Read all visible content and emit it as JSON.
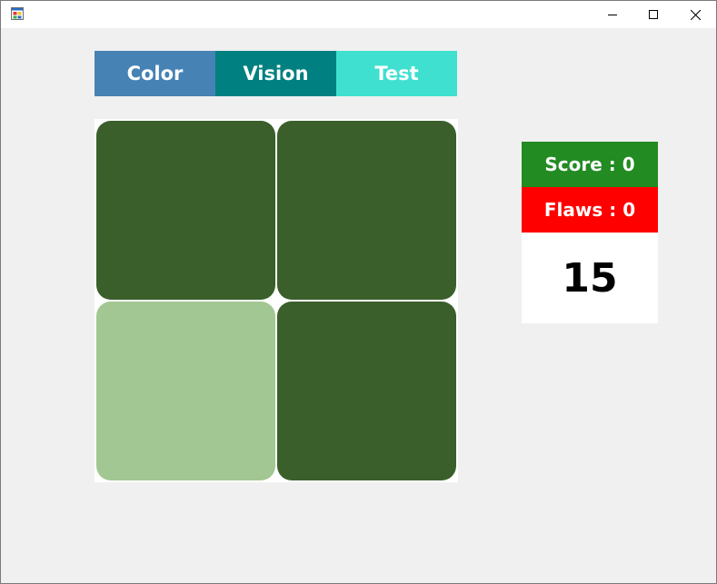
{
  "window": {
    "controls": {
      "minimize_icon": "minimize-icon",
      "maximize_icon": "maximize-icon",
      "close_icon": "close-icon"
    }
  },
  "tabs": [
    {
      "label": "Color",
      "color": "#4682b4"
    },
    {
      "label": "Vision",
      "color": "#008080"
    },
    {
      "label": "Test",
      "color": "#40e0d0"
    }
  ],
  "board": {
    "grid_size": 2,
    "tiles": [
      {
        "color": "#3a5f2b"
      },
      {
        "color": "#3a5f2b"
      },
      {
        "color": "#a2c792"
      },
      {
        "color": "#3a5f2b"
      }
    ]
  },
  "stats": {
    "score_text": "Score : 0",
    "score_color": "#228b22",
    "flaws_text": "Flaws : 0",
    "flaws_color": "#ff0000",
    "timer": "15"
  }
}
